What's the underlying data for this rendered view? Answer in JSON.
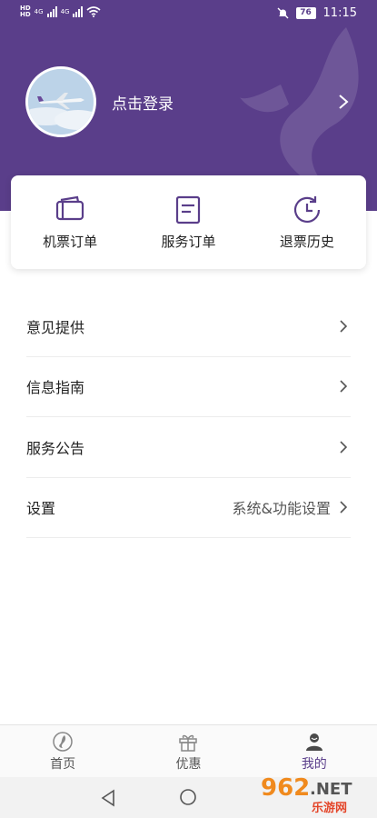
{
  "status_bar": {
    "network_1": "4G",
    "network_2": "4G",
    "battery": "76",
    "time": "11:15"
  },
  "header": {
    "login_label": "点击登录"
  },
  "quick_actions": [
    {
      "label": "机票订单",
      "icon": "ticket-icon"
    },
    {
      "label": "服务订单",
      "icon": "document-icon"
    },
    {
      "label": "退票历史",
      "icon": "history-clock-icon"
    }
  ],
  "menu": {
    "feedback": "意见提供",
    "guide": "信息指南",
    "notice": "服务公告",
    "settings": "设置",
    "settings_value": "系统&功能设置"
  },
  "tabs": [
    {
      "label": "首页",
      "icon": "home-logo-icon",
      "active": false
    },
    {
      "label": "优惠",
      "icon": "gift-icon",
      "active": false
    },
    {
      "label": "我的",
      "icon": "user-icon",
      "active": true
    }
  ],
  "watermark": {
    "number": "962",
    "suffix": ".NET",
    "text": "乐游网"
  },
  "colors": {
    "primary": "#5a3e8a",
    "watermark_orange": "#f08a1e",
    "watermark_red": "#e4462a"
  }
}
